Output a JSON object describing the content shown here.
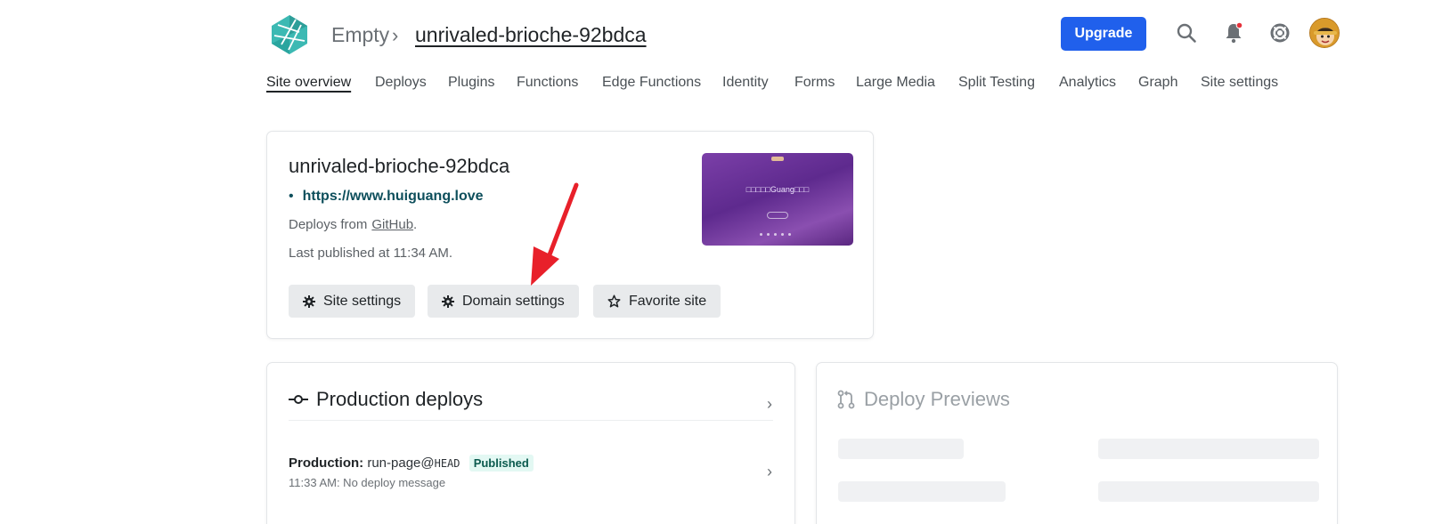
{
  "header": {
    "team_name": "Empty",
    "separator": "›",
    "site_name": "unrivaled-brioche-92bdca",
    "upgrade_label": "Upgrade",
    "icons": [
      "search-icon",
      "bell-icon",
      "help-lifebuoy-icon",
      "avatar"
    ],
    "accent_color": "#2060ec",
    "notification_dot_color": "#e5323b"
  },
  "nav": {
    "items": [
      {
        "label": "Site overview",
        "active": true
      },
      {
        "label": "Deploys"
      },
      {
        "label": "Plugins"
      },
      {
        "label": "Functions"
      },
      {
        "label": "Edge Functions"
      },
      {
        "label": "Identity"
      },
      {
        "label": "Forms"
      },
      {
        "label": "Large Media"
      },
      {
        "label": "Split Testing"
      },
      {
        "label": "Analytics"
      },
      {
        "label": "Graph"
      },
      {
        "label": "Site settings"
      }
    ]
  },
  "site_card": {
    "title": "unrivaled-brioche-92bdca",
    "url": "https://www.huiguang.love",
    "deploys_from_prefix": "Deploys from",
    "deploys_from_link": "GitHub",
    "deploys_from_suffix": ".",
    "last_published": "Last published at 11:34 AM.",
    "buttons": {
      "site_settings": "Site settings",
      "domain_settings": "Domain settings",
      "favorite_site": "Favorite site"
    },
    "preview": {
      "title_text": "□□□□□Guang□□□"
    }
  },
  "production": {
    "title": "Production deploys",
    "deploy": {
      "label": "Production:",
      "branch": "run-page@",
      "ref": "HEAD",
      "status": "Published",
      "time_message": "11:33 AM: No deploy message"
    }
  },
  "previews": {
    "title": "Deploy Previews"
  }
}
